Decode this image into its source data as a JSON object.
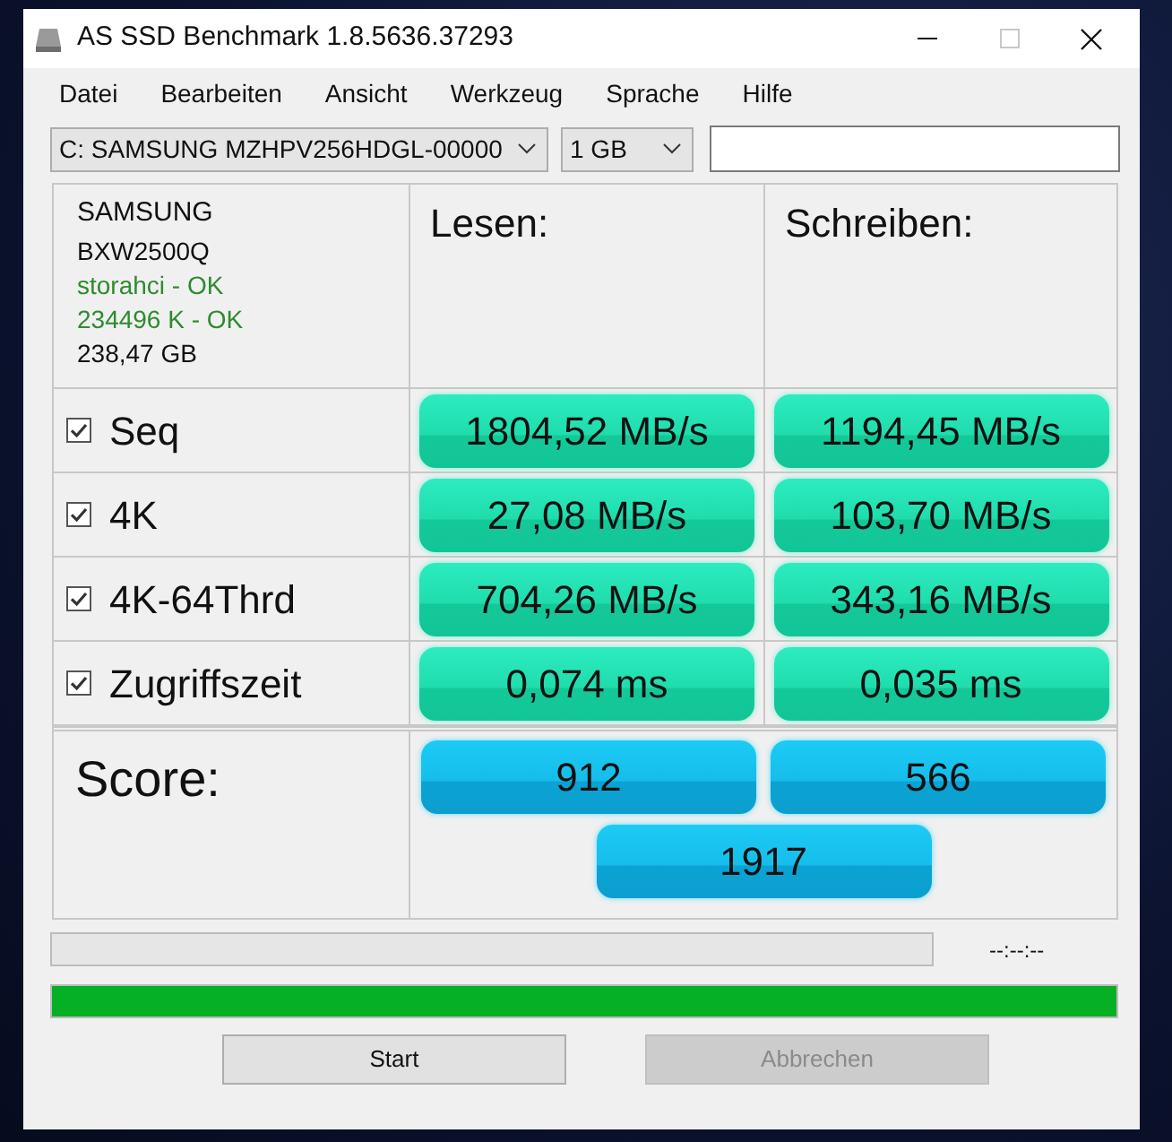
{
  "window": {
    "title": "AS SSD Benchmark 1.8.5636.37293"
  },
  "menu": [
    "Datei",
    "Bearbeiten",
    "Ansicht",
    "Werkzeug",
    "Sprache",
    "Hilfe"
  ],
  "drive_select": {
    "value": "C: SAMSUNG MZHPV256HDGL-00000"
  },
  "size_select": {
    "value": "1 GB"
  },
  "drive_info": [
    {
      "text": "SAMSUNG",
      "kind": "name"
    },
    {
      "text": "BXW2500Q",
      "kind": "info"
    },
    {
      "text": "storahci - OK",
      "kind": "ok"
    },
    {
      "text": "234496 K - OK",
      "kind": "ok"
    },
    {
      "text": "238,47 GB",
      "kind": "info"
    }
  ],
  "columns": [
    "Lesen:",
    "Schreiben:"
  ],
  "tests": [
    {
      "label": "Seq",
      "checked": true,
      "read": "1804,52 MB/s",
      "write": "1194,45 MB/s"
    },
    {
      "label": "4K",
      "checked": true,
      "read": "27,08 MB/s",
      "write": "103,70 MB/s"
    },
    {
      "label": "4K-64Thrd",
      "checked": true,
      "read": "704,26 MB/s",
      "write": "343,16 MB/s"
    },
    {
      "label": "Zugriffszeit",
      "checked": true,
      "read": "0,074 ms",
      "write": "0,035 ms"
    }
  ],
  "score": {
    "label": "Score:",
    "read": "912",
    "write": "566",
    "total": "1917"
  },
  "test_progress": {
    "time": "--:--:--"
  },
  "total_progress": {
    "level": 1
  },
  "buttons": [
    {
      "label": "Start",
      "disabled": false
    },
    {
      "label": "Abbrechen",
      "disabled": true
    }
  ]
}
